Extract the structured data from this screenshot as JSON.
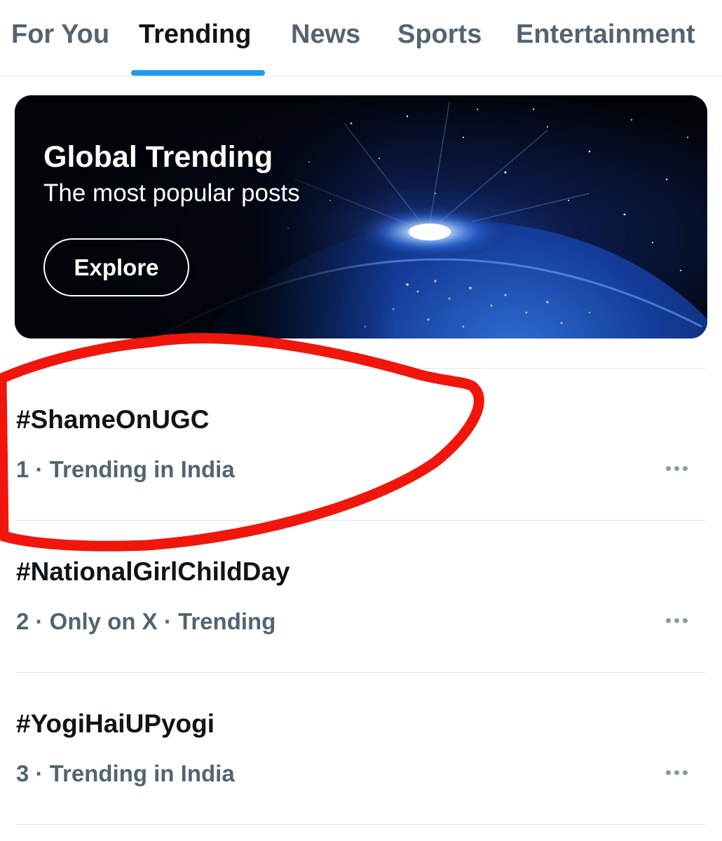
{
  "tabs": [
    {
      "label": "For You",
      "active": false
    },
    {
      "label": "Trending",
      "active": true
    },
    {
      "label": "News",
      "active": false
    },
    {
      "label": "Sports",
      "active": false
    },
    {
      "label": "Entertainment",
      "active": false
    }
  ],
  "banner": {
    "title": "Global Trending",
    "subtitle": "The most popular posts",
    "button_label": "Explore"
  },
  "trends": [
    {
      "name": "#ShameOnUGC",
      "meta": "1 · Trending in India",
      "highlighted": true
    },
    {
      "name": "#NationalGirlChildDay",
      "meta": "2 · Only on X · Trending",
      "highlighted": false
    },
    {
      "name": "#YogiHaiUPyogi",
      "meta": "3 · Trending in India",
      "highlighted": false
    }
  ],
  "icons": {
    "more": "more-horizontal-icon",
    "banner_art": "earth-sunrise-illustration"
  },
  "colors": {
    "accent": "#1d9bf0",
    "text_primary": "#0f1419",
    "text_secondary": "#536471",
    "annotation": "#f0160b"
  }
}
